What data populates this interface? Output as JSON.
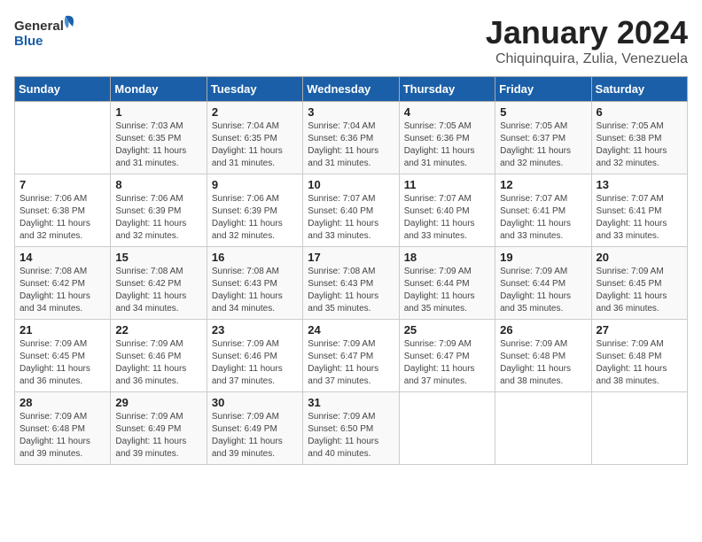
{
  "header": {
    "logo_general": "General",
    "logo_blue": "Blue",
    "title": "January 2024",
    "subtitle": "Chiquinquira, Zulia, Venezuela"
  },
  "days_of_week": [
    "Sunday",
    "Monday",
    "Tuesday",
    "Wednesday",
    "Thursday",
    "Friday",
    "Saturday"
  ],
  "weeks": [
    [
      {
        "day": "",
        "sunrise": "",
        "sunset": "",
        "daylight": ""
      },
      {
        "day": "1",
        "sunrise": "Sunrise: 7:03 AM",
        "sunset": "Sunset: 6:35 PM",
        "daylight": "Daylight: 11 hours and 31 minutes."
      },
      {
        "day": "2",
        "sunrise": "Sunrise: 7:04 AM",
        "sunset": "Sunset: 6:35 PM",
        "daylight": "Daylight: 11 hours and 31 minutes."
      },
      {
        "day": "3",
        "sunrise": "Sunrise: 7:04 AM",
        "sunset": "Sunset: 6:36 PM",
        "daylight": "Daylight: 11 hours and 31 minutes."
      },
      {
        "day": "4",
        "sunrise": "Sunrise: 7:05 AM",
        "sunset": "Sunset: 6:36 PM",
        "daylight": "Daylight: 11 hours and 31 minutes."
      },
      {
        "day": "5",
        "sunrise": "Sunrise: 7:05 AM",
        "sunset": "Sunset: 6:37 PM",
        "daylight": "Daylight: 11 hours and 32 minutes."
      },
      {
        "day": "6",
        "sunrise": "Sunrise: 7:05 AM",
        "sunset": "Sunset: 6:38 PM",
        "daylight": "Daylight: 11 hours and 32 minutes."
      }
    ],
    [
      {
        "day": "7",
        "sunrise": "Sunrise: 7:06 AM",
        "sunset": "Sunset: 6:38 PM",
        "daylight": "Daylight: 11 hours and 32 minutes."
      },
      {
        "day": "8",
        "sunrise": "Sunrise: 7:06 AM",
        "sunset": "Sunset: 6:39 PM",
        "daylight": "Daylight: 11 hours and 32 minutes."
      },
      {
        "day": "9",
        "sunrise": "Sunrise: 7:06 AM",
        "sunset": "Sunset: 6:39 PM",
        "daylight": "Daylight: 11 hours and 32 minutes."
      },
      {
        "day": "10",
        "sunrise": "Sunrise: 7:07 AM",
        "sunset": "Sunset: 6:40 PM",
        "daylight": "Daylight: 11 hours and 33 minutes."
      },
      {
        "day": "11",
        "sunrise": "Sunrise: 7:07 AM",
        "sunset": "Sunset: 6:40 PM",
        "daylight": "Daylight: 11 hours and 33 minutes."
      },
      {
        "day": "12",
        "sunrise": "Sunrise: 7:07 AM",
        "sunset": "Sunset: 6:41 PM",
        "daylight": "Daylight: 11 hours and 33 minutes."
      },
      {
        "day": "13",
        "sunrise": "Sunrise: 7:07 AM",
        "sunset": "Sunset: 6:41 PM",
        "daylight": "Daylight: 11 hours and 33 minutes."
      }
    ],
    [
      {
        "day": "14",
        "sunrise": "Sunrise: 7:08 AM",
        "sunset": "Sunset: 6:42 PM",
        "daylight": "Daylight: 11 hours and 34 minutes."
      },
      {
        "day": "15",
        "sunrise": "Sunrise: 7:08 AM",
        "sunset": "Sunset: 6:42 PM",
        "daylight": "Daylight: 11 hours and 34 minutes."
      },
      {
        "day": "16",
        "sunrise": "Sunrise: 7:08 AM",
        "sunset": "Sunset: 6:43 PM",
        "daylight": "Daylight: 11 hours and 34 minutes."
      },
      {
        "day": "17",
        "sunrise": "Sunrise: 7:08 AM",
        "sunset": "Sunset: 6:43 PM",
        "daylight": "Daylight: 11 hours and 35 minutes."
      },
      {
        "day": "18",
        "sunrise": "Sunrise: 7:09 AM",
        "sunset": "Sunset: 6:44 PM",
        "daylight": "Daylight: 11 hours and 35 minutes."
      },
      {
        "day": "19",
        "sunrise": "Sunrise: 7:09 AM",
        "sunset": "Sunset: 6:44 PM",
        "daylight": "Daylight: 11 hours and 35 minutes."
      },
      {
        "day": "20",
        "sunrise": "Sunrise: 7:09 AM",
        "sunset": "Sunset: 6:45 PM",
        "daylight": "Daylight: 11 hours and 36 minutes."
      }
    ],
    [
      {
        "day": "21",
        "sunrise": "Sunrise: 7:09 AM",
        "sunset": "Sunset: 6:45 PM",
        "daylight": "Daylight: 11 hours and 36 minutes."
      },
      {
        "day": "22",
        "sunrise": "Sunrise: 7:09 AM",
        "sunset": "Sunset: 6:46 PM",
        "daylight": "Daylight: 11 hours and 36 minutes."
      },
      {
        "day": "23",
        "sunrise": "Sunrise: 7:09 AM",
        "sunset": "Sunset: 6:46 PM",
        "daylight": "Daylight: 11 hours and 37 minutes."
      },
      {
        "day": "24",
        "sunrise": "Sunrise: 7:09 AM",
        "sunset": "Sunset: 6:47 PM",
        "daylight": "Daylight: 11 hours and 37 minutes."
      },
      {
        "day": "25",
        "sunrise": "Sunrise: 7:09 AM",
        "sunset": "Sunset: 6:47 PM",
        "daylight": "Daylight: 11 hours and 37 minutes."
      },
      {
        "day": "26",
        "sunrise": "Sunrise: 7:09 AM",
        "sunset": "Sunset: 6:48 PM",
        "daylight": "Daylight: 11 hours and 38 minutes."
      },
      {
        "day": "27",
        "sunrise": "Sunrise: 7:09 AM",
        "sunset": "Sunset: 6:48 PM",
        "daylight": "Daylight: 11 hours and 38 minutes."
      }
    ],
    [
      {
        "day": "28",
        "sunrise": "Sunrise: 7:09 AM",
        "sunset": "Sunset: 6:48 PM",
        "daylight": "Daylight: 11 hours and 39 minutes."
      },
      {
        "day": "29",
        "sunrise": "Sunrise: 7:09 AM",
        "sunset": "Sunset: 6:49 PM",
        "daylight": "Daylight: 11 hours and 39 minutes."
      },
      {
        "day": "30",
        "sunrise": "Sunrise: 7:09 AM",
        "sunset": "Sunset: 6:49 PM",
        "daylight": "Daylight: 11 hours and 39 minutes."
      },
      {
        "day": "31",
        "sunrise": "Sunrise: 7:09 AM",
        "sunset": "Sunset: 6:50 PM",
        "daylight": "Daylight: 11 hours and 40 minutes."
      },
      {
        "day": "",
        "sunrise": "",
        "sunset": "",
        "daylight": ""
      },
      {
        "day": "",
        "sunrise": "",
        "sunset": "",
        "daylight": ""
      },
      {
        "day": "",
        "sunrise": "",
        "sunset": "",
        "daylight": ""
      }
    ]
  ]
}
